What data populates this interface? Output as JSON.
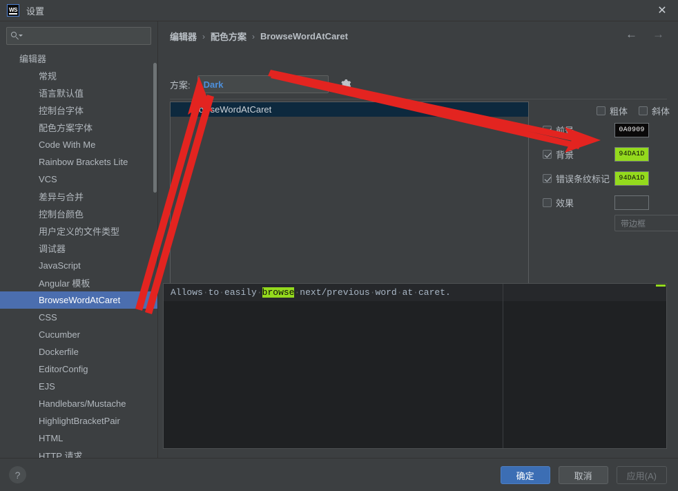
{
  "window": {
    "title": "设置",
    "logo_text": "WS",
    "close_icon": "✕"
  },
  "sidebar": {
    "search": {
      "value": "",
      "placeholder": ""
    },
    "root_label": "编辑器",
    "items": [
      {
        "label": "常规",
        "selected": false
      },
      {
        "label": "语言默认值",
        "selected": false
      },
      {
        "label": "控制台字体",
        "selected": false
      },
      {
        "label": "配色方案字体",
        "selected": false
      },
      {
        "label": "Code With Me",
        "selected": false
      },
      {
        "label": "Rainbow Brackets Lite",
        "selected": false
      },
      {
        "label": "VCS",
        "selected": false
      },
      {
        "label": "差异与合并",
        "selected": false
      },
      {
        "label": "控制台颜色",
        "selected": false
      },
      {
        "label": "用户定义的文件类型",
        "selected": false
      },
      {
        "label": "调试器",
        "selected": false
      },
      {
        "label": "JavaScript",
        "selected": false
      },
      {
        "label": "Angular 模板",
        "selected": false
      },
      {
        "label": "BrowseWordAtCaret",
        "selected": true
      },
      {
        "label": "CSS",
        "selected": false
      },
      {
        "label": "Cucumber",
        "selected": false
      },
      {
        "label": "Dockerfile",
        "selected": false
      },
      {
        "label": "EditorConfig",
        "selected": false
      },
      {
        "label": "EJS",
        "selected": false
      },
      {
        "label": "Handlebars/Mustache",
        "selected": false
      },
      {
        "label": "HighlightBracketPair",
        "selected": false
      },
      {
        "label": "HTML",
        "selected": false
      },
      {
        "label": "HTTP 请求",
        "selected": false
      }
    ]
  },
  "breadcrumb": {
    "part1": "编辑器",
    "sep1": "›",
    "part2": "配色方案",
    "sep2": "›",
    "part3": "BrowseWordAtCaret"
  },
  "nav": {
    "back_icon": "←",
    "forward_icon": "→"
  },
  "scheme": {
    "label": "方案:",
    "value": "Dark",
    "gear_icon": "gear-icon"
  },
  "scheme_list": {
    "rows": [
      {
        "label": "BrowseWordAtCaret",
        "selected": true
      }
    ]
  },
  "attributes": {
    "bold": {
      "label": "粗体",
      "checked": false
    },
    "italic": {
      "label": "斜体",
      "checked": false
    },
    "foreground": {
      "label": "前景",
      "checked": true,
      "color_text": "0A0909",
      "bg": "#0a0909",
      "fg": "#f2f2f2"
    },
    "background": {
      "label": "背景",
      "checked": true,
      "color_text": "94DA1D",
      "bg": "#94da1d",
      "fg": "#0a0909"
    },
    "error_stripe": {
      "label": "错误条纹标记",
      "checked": true,
      "color_text": "94DA1D",
      "bg": "#94da1d",
      "fg": "#0a0909"
    },
    "effects": {
      "label": "效果",
      "checked": false,
      "color_text": ""
    },
    "effect_type": {
      "value": "带边框",
      "disabled": true
    }
  },
  "preview": {
    "line1": {
      "seg1": "Allows",
      "seg2": "to",
      "seg3": "easily",
      "highlight": "browse",
      "seg4": "next/previous",
      "seg5": "word",
      "seg6": "at",
      "seg7": "caret.",
      "space_dot": "·"
    },
    "marker_color": "#94da1d",
    "highlight_bg": "#94da1d",
    "highlight_fg": "#0a0909"
  },
  "footer": {
    "help_icon": "?",
    "ok": "确定",
    "cancel": "取消",
    "apply": "应用(A)"
  },
  "colors": {
    "accent_blue": "#4b6eaf",
    "selection_blue": "#0d293e",
    "link_blue": "#4d90dd",
    "green": "#94da1d",
    "annotation_red": "#e32420"
  }
}
